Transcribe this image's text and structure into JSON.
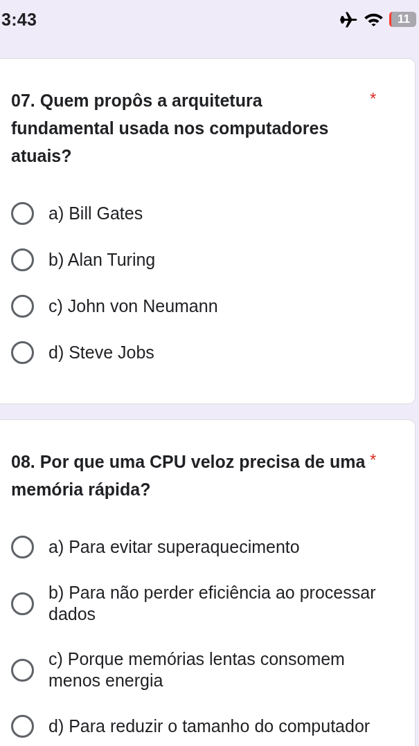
{
  "status_bar": {
    "time": "3:43",
    "battery": "11"
  },
  "questions": [
    {
      "title": "07. Quem propôs a arquitetura fundamental usada nos computadores atuais?",
      "required_mark": "*",
      "options": [
        {
          "label": "a) Bill Gates",
          "selected": false
        },
        {
          "label": "b) Alan Turing",
          "selected": false
        },
        {
          "label": "c) John von Neumann",
          "selected": false
        },
        {
          "label": "d) Steve Jobs",
          "selected": false
        }
      ]
    },
    {
      "title": "08. Por que uma CPU veloz precisa de uma memória rápida?",
      "required_mark": "*",
      "options": [
        {
          "label": "a) Para evitar superaquecimento",
          "selected": false
        },
        {
          "label": "b) Para não perder eficiência ao processar dados",
          "selected": false
        },
        {
          "label": "c) Porque memórias lentas consomem menos energia",
          "selected": false
        },
        {
          "label": "d) Para reduzir o tamanho do computador",
          "selected": false
        }
      ]
    }
  ]
}
